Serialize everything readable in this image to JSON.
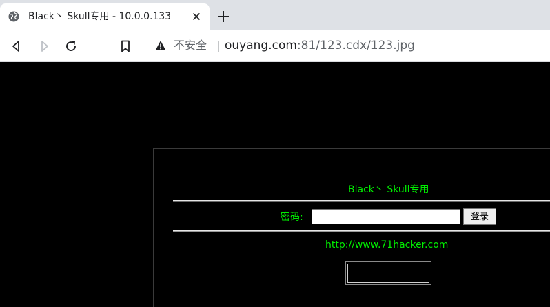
{
  "browser": {
    "tab": {
      "title": "Black丶 Skull专用 - 10.0.0.133"
    },
    "address_bar": {
      "security_label": "不安全",
      "separator": "|",
      "url_host": "ouyang.com",
      "url_path": ":81/123.cdx/123.jpg"
    }
  },
  "page": {
    "title": "Black丶 Skull专用",
    "password_label": "密码:",
    "password_value": "",
    "login_button": "登录",
    "link_text": "http://www.71hacker.com"
  },
  "colors": {
    "background": "#000000",
    "text_accent": "#00ee00",
    "tabstrip": "#dee1e6"
  }
}
